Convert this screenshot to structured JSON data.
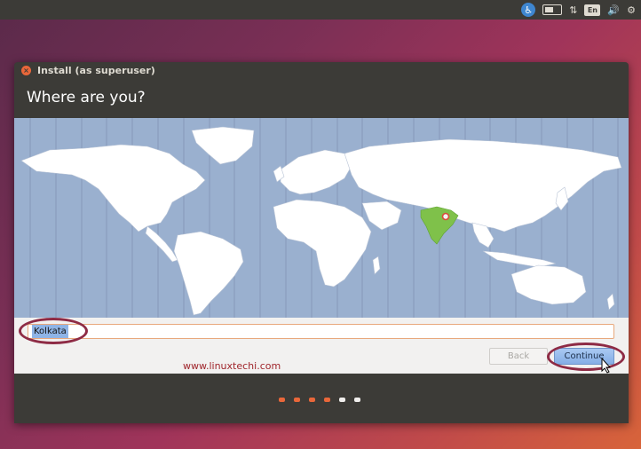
{
  "top_panel": {
    "icons": [
      "accessibility-icon",
      "battery-icon",
      "network-icon",
      "keyboard-layout-icon",
      "volume-icon",
      "settings-gear-icon"
    ],
    "keyboard_layout": "En"
  },
  "window": {
    "title": "Install (as superuser)",
    "heading": "Where are you?"
  },
  "location": {
    "input_value": "Kolkata",
    "selected_region": "India"
  },
  "buttons": {
    "back_label": "Back",
    "continue_label": "Continue"
  },
  "watermark": "www.linuxtechi.com",
  "progress": {
    "total_steps": 6,
    "completed_steps": 4
  },
  "colors": {
    "accent": "#e9673a",
    "highlight_oval": "#8e2b45",
    "map_ocean": "#9ab0cf",
    "selected_country": "#7fc14a"
  }
}
